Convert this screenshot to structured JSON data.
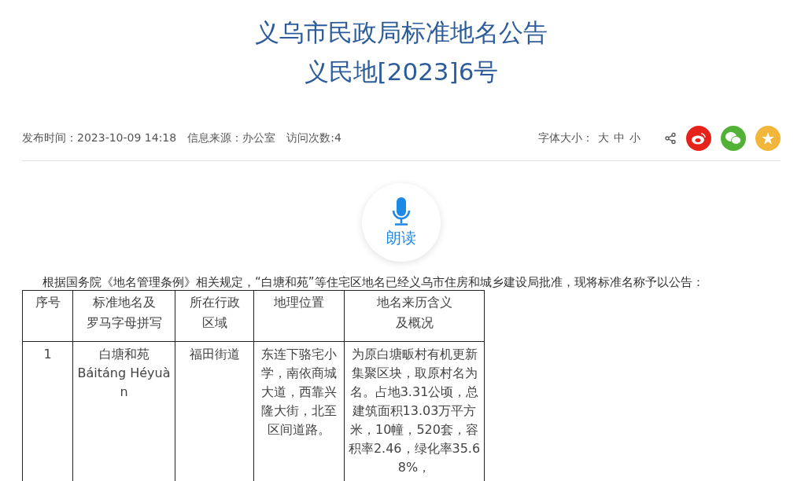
{
  "title": {
    "line_1": "义乌市民政局标准地名公告",
    "line_2": "义民地[2023]6号"
  },
  "meta": [
    "发布时间：2023-10-09 14:18",
    "信息来源：办公室",
    "访问次数:4"
  ],
  "font_size": {
    "label": "字体大小：",
    "options": [
      "大",
      "中",
      "小"
    ]
  },
  "read_button": {
    "label": "朗读"
  },
  "intro": "根据国务院《地名管理条例》相关规定，“白塘和苑”等住宅区地名已经义乌市住房和城乡建设局批准，现将标准名称予以公告：",
  "table": {
    "columns": [
      "序号",
      "标准地名及罗马字母拼写",
      "所在行政区域",
      "地理位置",
      "地名来历含义及概况"
    ],
    "rows": [
      [
        "1",
        "白塘和苑\nBáitáng Héyuàn",
        "福田街道",
        "东连下骆宅小学，南依商城大道，西靠兴隆大街，北至区间道路。",
        "为原白塘畈村有机更新集聚区块，取原村名为名。占地3.31公顷，总建筑面积13.03万平方米，10幢，520套，容积率2.46，绿化率35.68%，"
      ]
    ]
  }
}
